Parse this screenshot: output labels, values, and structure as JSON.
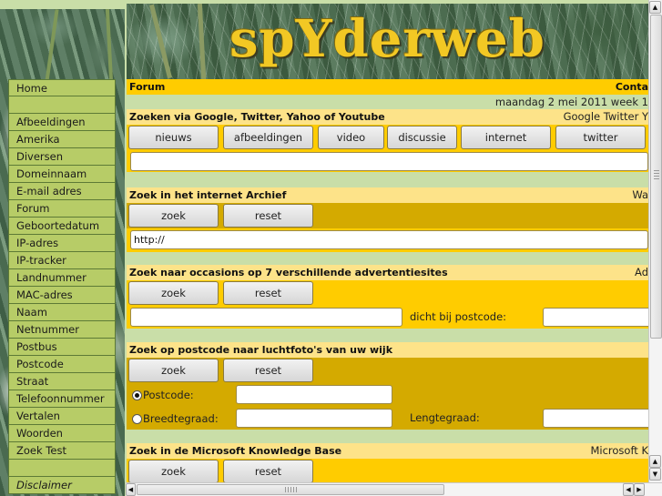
{
  "nav": {
    "items": [
      {
        "label": "Home"
      },
      {
        "label": ""
      },
      {
        "label": "Afbeeldingen"
      },
      {
        "label": "Amerika"
      },
      {
        "label": "Diversen"
      },
      {
        "label": "Domeinnaam"
      },
      {
        "label": "E-mail adres"
      },
      {
        "label": "Forum"
      },
      {
        "label": "Geboortedatum"
      },
      {
        "label": "IP-adres"
      },
      {
        "label": "IP-tracker"
      },
      {
        "label": "Landnummer"
      },
      {
        "label": "MAC-adres"
      },
      {
        "label": "Naam"
      },
      {
        "label": "Netnummer"
      },
      {
        "label": "Postbus"
      },
      {
        "label": "Postcode"
      },
      {
        "label": "Straat"
      },
      {
        "label": "Telefoonnummer"
      },
      {
        "label": "Vertalen"
      },
      {
        "label": "Woorden"
      },
      {
        "label": "Zoek Test"
      },
      {
        "label": ""
      },
      {
        "label": "Disclaimer"
      }
    ]
  },
  "header": {
    "logo": "spYderweb",
    "topbar_left": "Forum",
    "topbar_right": "Conta",
    "date": "maandag 2 mei 2011 week 1"
  },
  "sections": {
    "search": {
      "title": "Zoeken via Google, Twitter, Yahoo of Youtube",
      "right": "Google  Twitter  Y",
      "buttons": [
        "nieuws",
        "afbeeldingen",
        "video",
        "discussie",
        "internet",
        "twitter"
      ],
      "input_value": ""
    },
    "archive": {
      "title": "Zoek in het internet Archief",
      "right": "Wa",
      "zoek": "zoek",
      "reset": "reset",
      "input_value": "http://"
    },
    "occasions": {
      "title": "Zoek naar occasions op 7 verschillende advertentiesites",
      "right": "Ad",
      "zoek": "zoek",
      "reset": "reset",
      "input_value": "",
      "postcode_label": "dicht bij postcode:",
      "postcode_value": ""
    },
    "luchtfoto": {
      "title": "Zoek op postcode naar luchtfoto's van uw wijk",
      "zoek": "zoek",
      "reset": "reset",
      "radio_postcode": "Postcode:",
      "radio_breedte": "Breedtegraad:",
      "lengte_label": "Lengtegraad:",
      "selected": "Postcode:",
      "postcode_value": "",
      "breedte_value": "",
      "lengte_value": ""
    },
    "microsoft": {
      "title": "Zoek in de Microsoft Knowledge Base",
      "right": "Microsoft K",
      "zoek": "zoek",
      "reset": "reset"
    }
  },
  "colors": {
    "page_bg": "#c9dea8",
    "nav_item": "#b7cc67",
    "yellow_bar": "#ffcc00",
    "section_head": "#fde389",
    "dark_band": "#d4aa00",
    "logo": "#f2c824"
  }
}
